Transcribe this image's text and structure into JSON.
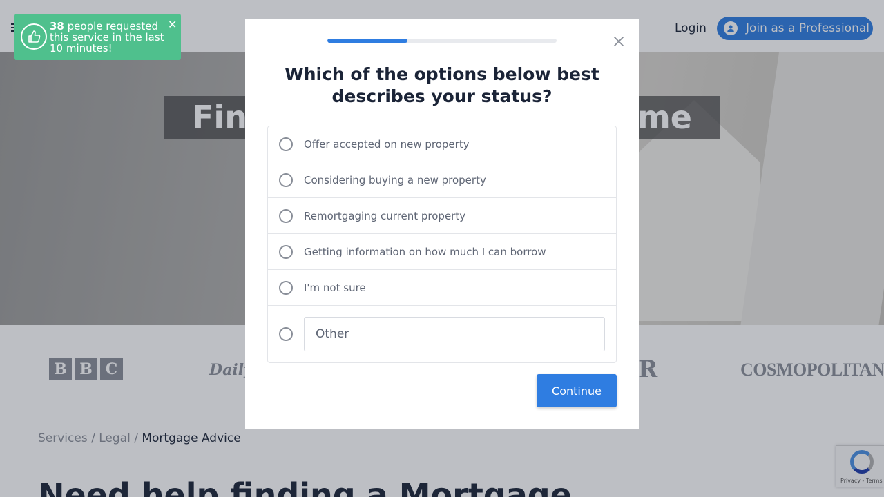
{
  "header": {
    "login_label": "Login",
    "join_label": "Join as a Professional"
  },
  "hero": {
    "title_left": "Find",
    "title_right": "me"
  },
  "logos": {
    "bbc": [
      "B",
      "B",
      "C"
    ],
    "daily": "Daily",
    "magazine": "R",
    "cosmopolitan": "COSMOPOLITAN"
  },
  "breadcrumb": {
    "items": [
      "Services",
      "Legal"
    ],
    "separator": "/",
    "current": "Mortgage Advice"
  },
  "page_heading": "Need help finding a Mortgage",
  "toast": {
    "count": "38",
    "message": "people requested this service in the last 10 minutes!",
    "close_glyph": "✕",
    "color": "#4fc08d"
  },
  "modal": {
    "progress_fraction": 0.35,
    "question": "Which of the options below best describes your status?",
    "options": [
      "Offer accepted on new property",
      "Considering buying a new property",
      "Remortgaging current property",
      "Getting information on how much I can borrow",
      "I'm not sure"
    ],
    "other_placeholder": "Other",
    "continue_label": "Continue",
    "accent_color": "#2f7de1"
  },
  "recaptcha": {
    "text": "Privacy - Terms"
  }
}
